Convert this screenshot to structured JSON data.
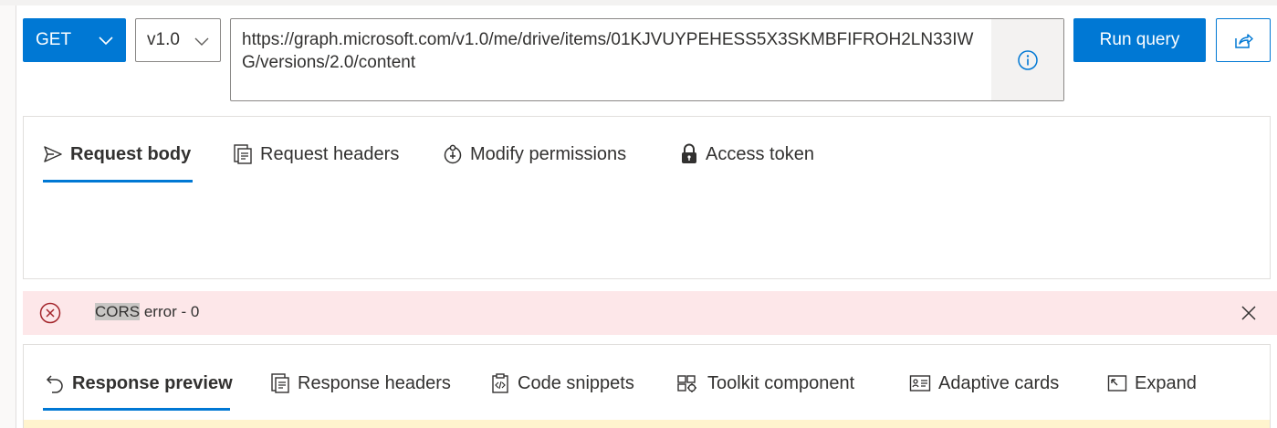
{
  "query": {
    "method": "GET",
    "version": "v1.0",
    "url": "https://graph.microsoft.com/v1.0/me/drive/items/01KJVUYPEHESS5X3SKMBFIFROH2LN33IWG/versions/2.0/content",
    "run_label": "Run query"
  },
  "request_tabs": [
    {
      "label": "Request body",
      "icon": "send-icon",
      "active": true
    },
    {
      "label": "Request headers",
      "icon": "headers-icon",
      "active": false
    },
    {
      "label": "Modify permissions",
      "icon": "permissions-icon",
      "active": false
    },
    {
      "label": "Access token",
      "icon": "lock-icon",
      "active": false
    }
  ],
  "error": {
    "highlight": "CORS",
    "rest": " error - 0"
  },
  "response_tabs": [
    {
      "label": "Response preview",
      "icon": "undo-icon",
      "active": true
    },
    {
      "label": "Response headers",
      "icon": "headers-icon",
      "active": false
    },
    {
      "label": "Code snippets",
      "icon": "code-snippets-icon",
      "active": false
    },
    {
      "label": "Toolkit component",
      "icon": "toolkit-icon",
      "active": false
    },
    {
      "label": "Adaptive cards",
      "icon": "adaptive-card-icon",
      "active": false
    },
    {
      "label": "Expand",
      "icon": "expand-icon",
      "active": false
    }
  ],
  "colors": {
    "accent": "#0078d4",
    "error_bg": "#fde7e9",
    "error_icon": "#a4262c",
    "warning_bg": "#fff4ce"
  }
}
